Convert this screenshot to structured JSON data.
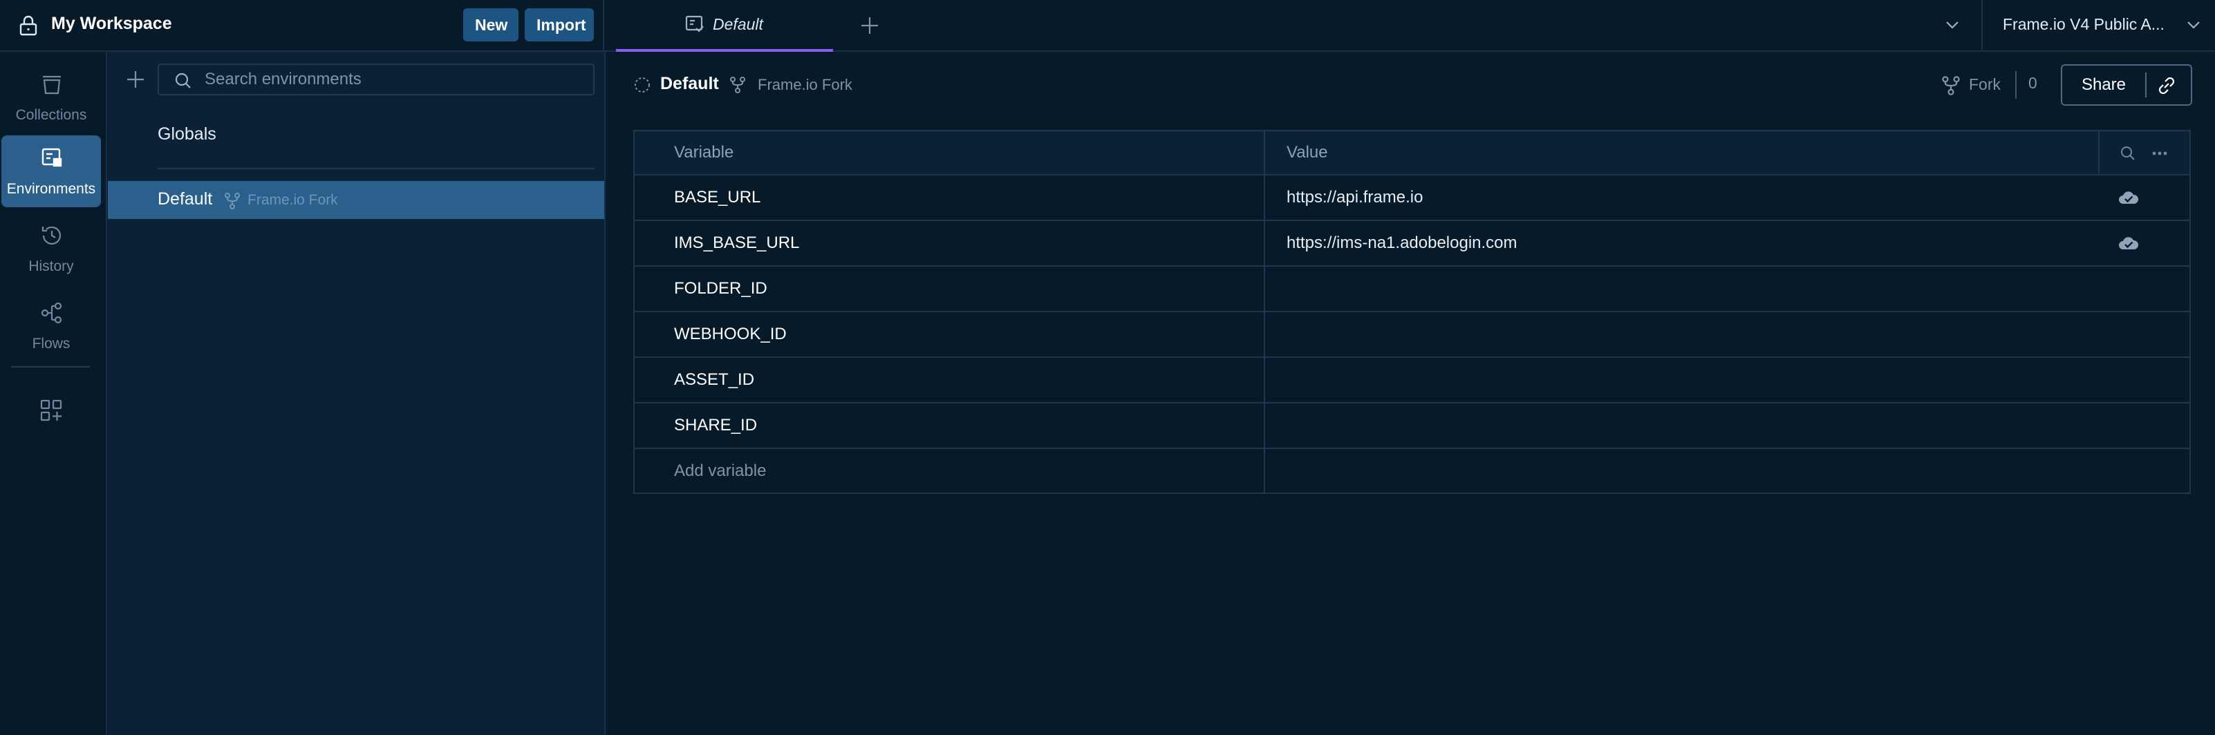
{
  "topbar": {
    "workspace_title": "My Workspace",
    "new_label": "New",
    "import_label": "Import",
    "active_tab_label": "Default",
    "workspace_selector_label": "Frame.io V4 Public A..."
  },
  "rail": {
    "items": [
      {
        "label": "Collections",
        "icon": "collections-icon"
      },
      {
        "label": "Environments",
        "icon": "environments-icon",
        "active": true
      },
      {
        "label": "History",
        "icon": "history-icon"
      },
      {
        "label": "Flows",
        "icon": "flows-icon"
      }
    ]
  },
  "env_panel": {
    "search_placeholder": "Search environments",
    "globals_label": "Globals",
    "selected_env_name": "Default",
    "selected_env_fork": "Frame.io Fork"
  },
  "main": {
    "env_name": "Default",
    "fork_source": "Frame.io Fork",
    "fork_label": "Fork",
    "fork_count": "0",
    "share_label": "Share",
    "table": {
      "headers": {
        "variable": "Variable",
        "value": "Value"
      },
      "rows": [
        {
          "variable": "BASE_URL",
          "value": "https://api.frame.io",
          "cloud": true
        },
        {
          "variable": "IMS_BASE_URL",
          "value": "https://ims-na1.adobelogin.com",
          "cloud": true
        },
        {
          "variable": "FOLDER_ID",
          "value": ""
        },
        {
          "variable": "WEBHOOK_ID",
          "value": ""
        },
        {
          "variable": "ASSET_ID",
          "value": ""
        },
        {
          "variable": "SHARE_ID",
          "value": ""
        }
      ],
      "add_variable_label": "Add variable"
    }
  },
  "colors": {
    "background": "#071a29",
    "panel": "#0b2236",
    "accent_blue": "#2b5f8c",
    "button_blue": "#1e5481",
    "tab_underline": "#8a5cf6"
  }
}
